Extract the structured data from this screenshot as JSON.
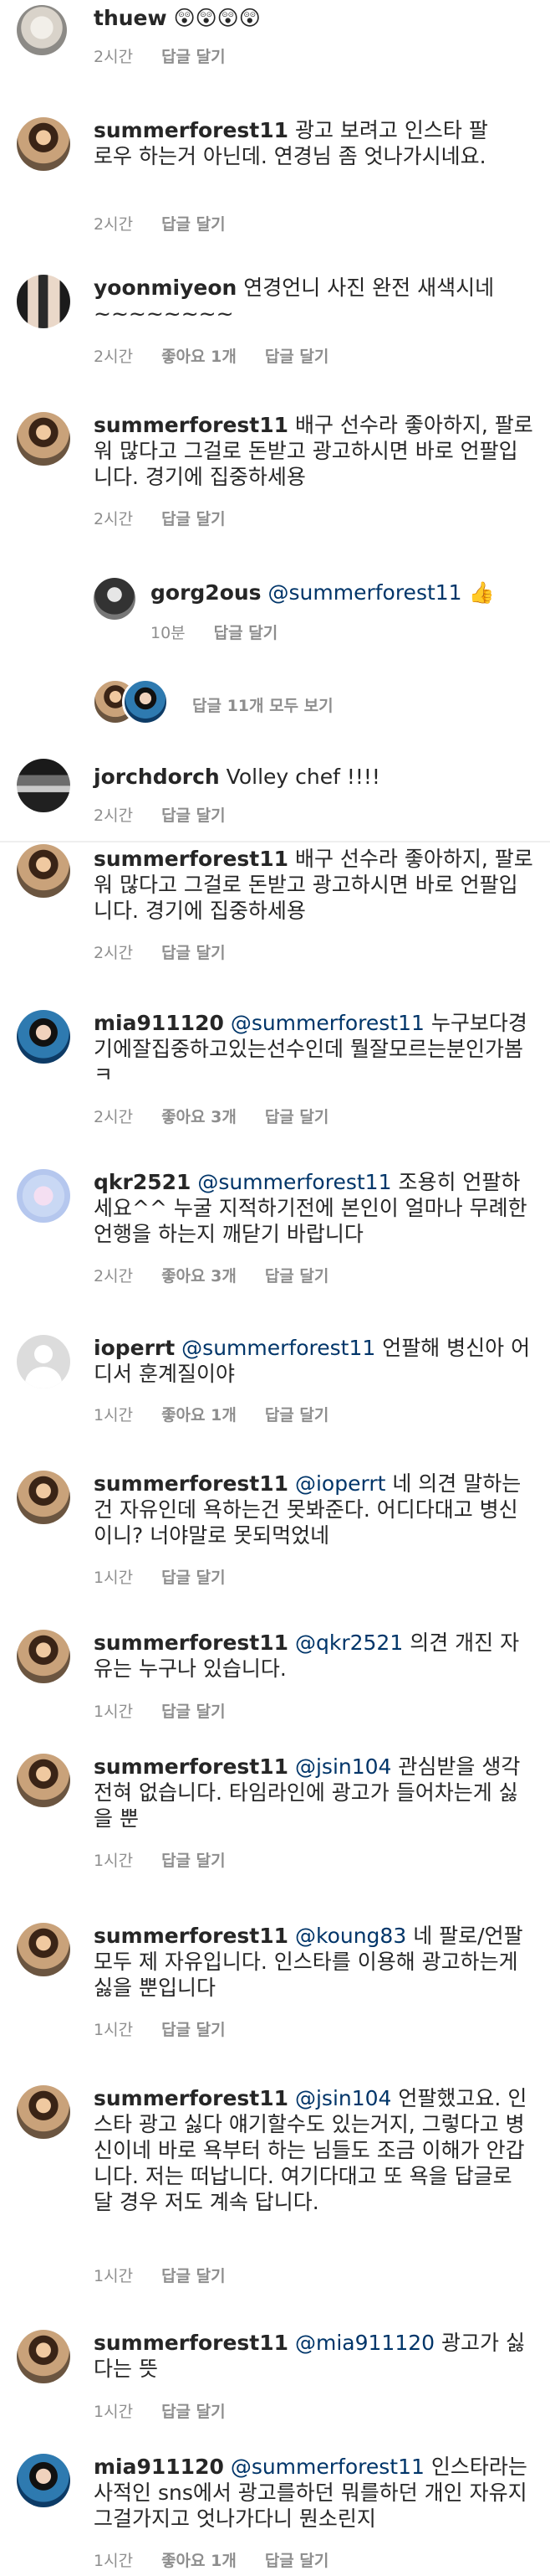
{
  "comments": [
    {
      "id": "c1",
      "user": "thuew",
      "mention": "",
      "text": "😲😲😲😲",
      "time": "2시간",
      "likes": "",
      "reply": "답글 달기"
    },
    {
      "id": "c2",
      "user": "summerforest11",
      "mention": "",
      "text": "광고 보려고 인스타 팔로우 하는거 아닌데. 연경님 좀 엇나가시네요.",
      "time": "2시간",
      "likes": "",
      "reply": "답글 달기"
    },
    {
      "id": "c3",
      "user": "yoonmiyeon",
      "mention": "",
      "text": "연경언니 사진 완전 새색시네~~~~~~~~",
      "time": "2시간",
      "likes": "좋아요 1개",
      "reply": "답글 달기"
    },
    {
      "id": "c4",
      "user": "summerforest11",
      "mention": "",
      "text": "배구 선수라 좋아하지, 팔로워 많다고 그걸로 돈받고 광고하시면 바로 언팔입니다. 경기에 집중하세용",
      "time": "2시간",
      "likes": "",
      "reply": "답글 달기"
    },
    {
      "id": "c5",
      "user": "gorg2ous",
      "mention": "@summerforest11",
      "text": "👍",
      "time": "10분",
      "likes": "",
      "reply": "답글 달기"
    },
    {
      "id": "c6",
      "user": "jorchdorch",
      "mention": "",
      "text": "Volley chef !!!!",
      "time": "2시간",
      "likes": "",
      "reply": "답글 달기"
    },
    {
      "id": "c7",
      "user": "summerforest11",
      "mention": "",
      "text": "배구 선수라 좋아하지, 팔로워 많다고 그걸로 돈받고 광고하시면 바로 언팔입니다. 경기에 집중하세용",
      "time": "2시간",
      "likes": "",
      "reply": "답글 달기"
    },
    {
      "id": "c8",
      "user": "mia911120",
      "mention": "@summerforest11",
      "text": "누구보다경기에잘집중하고있는선수인데 뭘잘모르는분인가봄ㅋ",
      "time": "2시간",
      "likes": "좋아요 3개",
      "reply": "답글 달기"
    },
    {
      "id": "c9",
      "user": "qkr2521",
      "mention": "@summerforest11",
      "text": "조용히 언팔하세요^^ 누굴 지적하기전에 본인이 얼마나 무례한 언행을 하는지 깨닫기 바랍니다",
      "time": "2시간",
      "likes": "좋아요 3개",
      "reply": "답글 달기"
    },
    {
      "id": "c10",
      "user": "ioperrt",
      "mention": "@summerforest11",
      "text": "언팔해 병신아 어디서 훈계질이야",
      "time": "1시간",
      "likes": "좋아요 1개",
      "reply": "답글 달기"
    },
    {
      "id": "c11",
      "user": "summerforest11",
      "mention": "@ioperrt",
      "text": "네 의견 말하는건 자유인데 욕하는건 못봐준다. 어디다대고 병신이니? 너야말로 못되먹었네",
      "time": "1시간",
      "likes": "",
      "reply": "답글 달기"
    },
    {
      "id": "c12",
      "user": "summerforest11",
      "mention": "@qkr2521",
      "text": "의견 개진 자유는 누구나 있습니다.",
      "time": "1시간",
      "likes": "",
      "reply": "답글 달기"
    },
    {
      "id": "c13",
      "user": "summerforest11",
      "mention": "@jsin104",
      "text": "관심받을 생각 전혀 없습니다. 타임라인에 광고가 들어차는게 싫을 뿐",
      "time": "1시간",
      "likes": "",
      "reply": "답글 달기"
    },
    {
      "id": "c14",
      "user": "summerforest11",
      "mention": "@koung83",
      "text": "네 팔로/언팔 모두 제 자유입니다. 인스타를 이용해 광고하는게 싫을 뿐입니다",
      "time": "1시간",
      "likes": "",
      "reply": "답글 달기"
    },
    {
      "id": "c15",
      "user": "summerforest11",
      "mention": "@jsin104",
      "text": "언팔했고요. 인스타 광고 싫다 얘기할수도 있는거지, 그렇다고 병신이네 바로 욕부터 하는 님들도 조금 이해가 안갑니다. 저는 떠납니다. 여기다대고 또 욕을 답글로 달 경우 저도 계속 답니다.",
      "time": "1시간",
      "likes": "",
      "reply": "답글 달기"
    },
    {
      "id": "c16",
      "user": "summerforest11",
      "mention": "@mia911120",
      "text": "광고가 싫다는 뜻",
      "time": "1시간",
      "likes": "",
      "reply": "답글 달기"
    },
    {
      "id": "c17",
      "user": "mia911120",
      "mention": "@summerforest11",
      "text": "인스타라는 사적인 sns에서 광고를하던 뭐를하던 개인 자유지 그걸가지고 엇나가다니 뭔소린지",
      "time": "1시간",
      "likes": "좋아요 1개",
      "reply": "답글 달기"
    }
  ],
  "replies_toggle": "답글 11개 모두 보기",
  "icons": {
    "thuew_avatar": "avatar-white-circle",
    "summerforest11_avatar": "avatar-woman-photo",
    "yoonmiyeon_avatar": "avatar-two-women",
    "gorg2ous_avatar": "avatar-volleyball-player",
    "jorchdorch_avatar": "avatar-stadium",
    "mia911120_avatar": "avatar-woman-blue",
    "qkr2521_avatar": "avatar-pastel-flowers",
    "ioperrt_avatar": "avatar-default-silhouette"
  }
}
